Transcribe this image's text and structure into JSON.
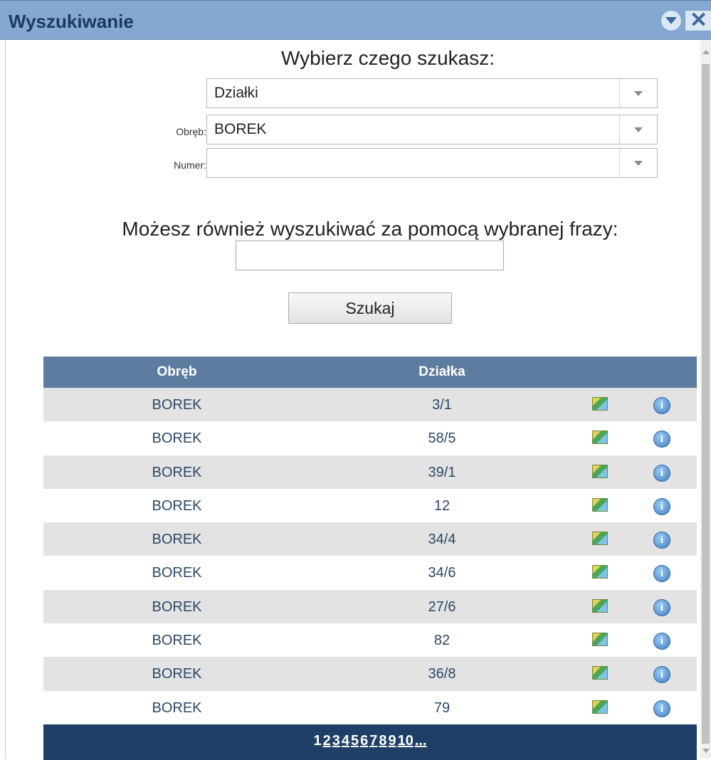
{
  "window": {
    "title": "Wyszukiwanie"
  },
  "form": {
    "heading": "Wybierz czego szukasz:",
    "type_select": {
      "value": "Działki"
    },
    "obreb": {
      "label": "Obręb:",
      "value": "BOREK"
    },
    "numer": {
      "label": "Numer:",
      "value": ""
    },
    "phrase_heading": "Możesz również wyszukiwać za pomocą wybranej frazy:",
    "phrase_value": "",
    "search_button": "Szukaj"
  },
  "table": {
    "columns": [
      "Obręb",
      "Działka"
    ],
    "rows": [
      [
        "BOREK",
        "3/1"
      ],
      [
        "BOREK",
        "58/5"
      ],
      [
        "BOREK",
        "39/1"
      ],
      [
        "BOREK",
        "12"
      ],
      [
        "BOREK",
        "34/4"
      ],
      [
        "BOREK",
        "34/6"
      ],
      [
        "BOREK",
        "27/6"
      ],
      [
        "BOREK",
        "82"
      ],
      [
        "BOREK",
        "36/8"
      ],
      [
        "BOREK",
        "79"
      ]
    ],
    "row_icons": [
      "map-icon",
      "info-icon"
    ],
    "pager": [
      "1",
      "2",
      "3",
      "4",
      "5",
      "6",
      "7",
      "8",
      "9",
      "10",
      "..."
    ],
    "current_page": "1"
  },
  "colors": {
    "titlebar": "#84a8d2",
    "table_header": "#5e7c9f",
    "pager_bg": "#203f66",
    "row_alt": "#e3e3e3",
    "row_text": "#2d4866"
  }
}
